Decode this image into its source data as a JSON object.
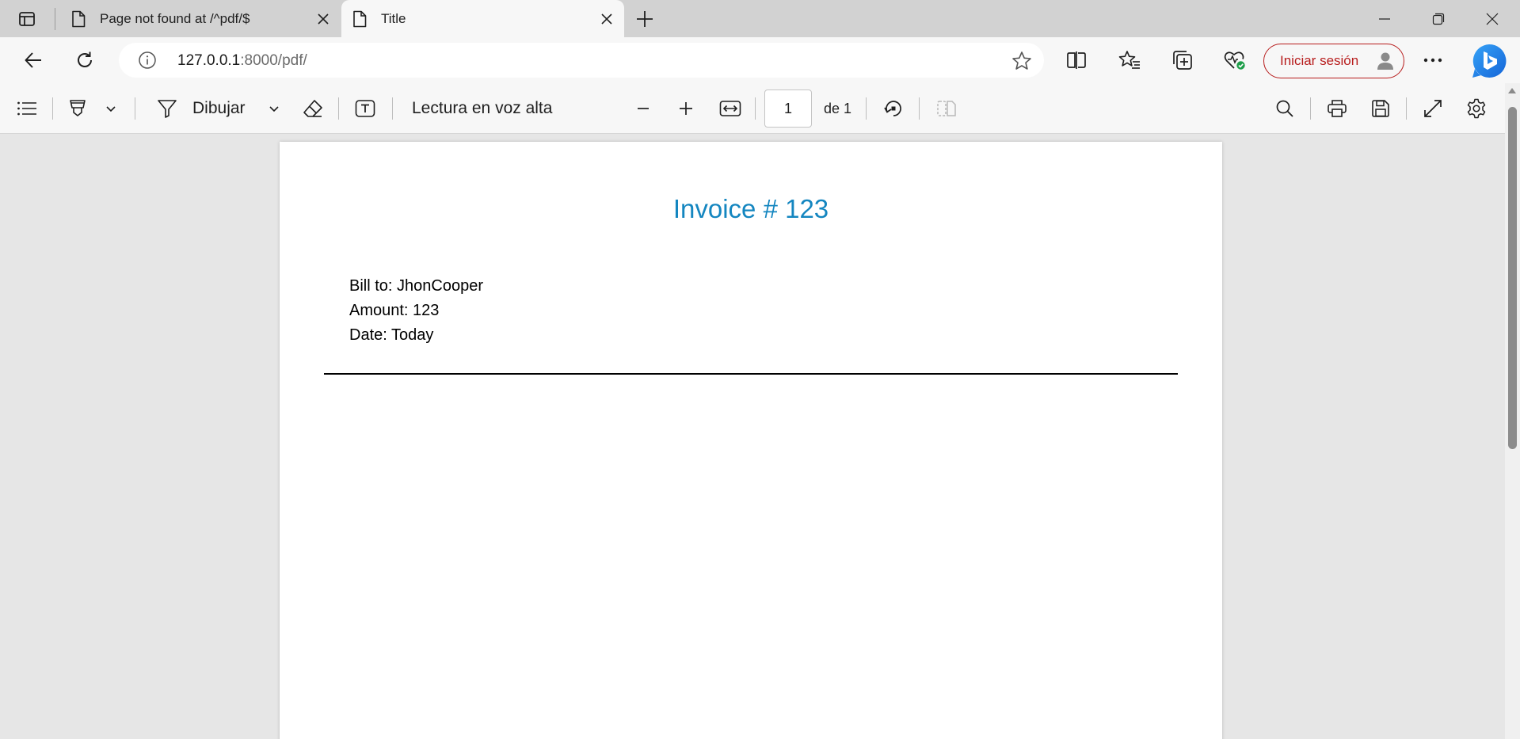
{
  "browser": {
    "tabs": [
      {
        "title": "Page not found at /^pdf/$",
        "active": false
      },
      {
        "title": "Title",
        "active": true
      }
    ],
    "address": {
      "host": "127.0.0.1",
      "rest": ":8000/pdf/"
    },
    "signin_label": "Iniciar sesión"
  },
  "pdf_toolbar": {
    "draw_label": "Dibujar",
    "read_aloud_label": "Lectura en voz alta",
    "page_number": "1",
    "page_total": "de 1"
  },
  "document": {
    "title": "Invoice # 123",
    "lines": [
      "Bill to: JhonCooper",
      "Amount: 123",
      "Date: Today"
    ]
  },
  "colors": {
    "title_blue": "#1486c0",
    "signin_red": "#b71c1c",
    "tab_strip": "#d2d2d2",
    "toolbar": "#f7f7f7",
    "viewer_bg": "#e6e6e6"
  },
  "icons": [
    "tab-actions-icon",
    "page-icon",
    "close-icon",
    "plus-icon",
    "minimize-icon",
    "restore-icon",
    "back-icon",
    "refresh-icon",
    "info-icon",
    "star-icon",
    "split-screen-icon",
    "favorites-icon",
    "collections-icon",
    "health-icon",
    "avatar-icon",
    "more-icon",
    "bing-icon",
    "contents-icon",
    "highlight-icon",
    "draw-icon",
    "eraser-icon",
    "text-icon",
    "zoom-out-icon",
    "zoom-in-icon",
    "fit-width-icon",
    "rotate-icon",
    "two-page-icon",
    "search-icon",
    "print-icon",
    "save-icon",
    "fullscreen-icon",
    "settings-icon"
  ]
}
